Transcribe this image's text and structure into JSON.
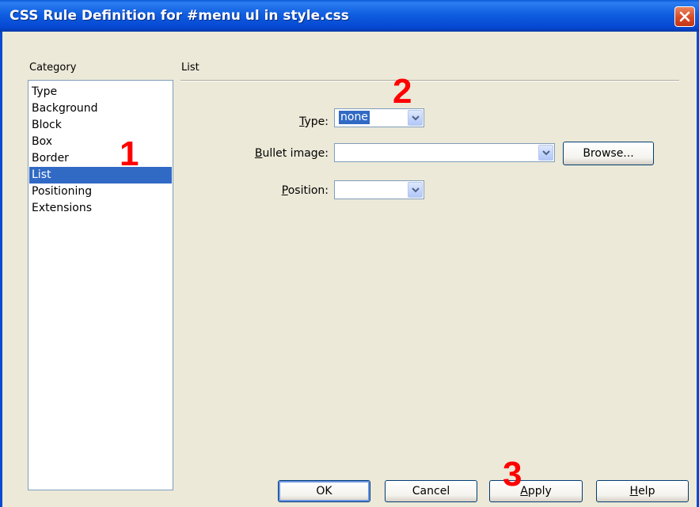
{
  "window": {
    "title": "CSS Rule Definition for #menu ul in style.css"
  },
  "category": {
    "label": "Category",
    "items": [
      "Type",
      "Background",
      "Block",
      "Box",
      "Border",
      "List",
      "Positioning",
      "Extensions"
    ],
    "selected": "List"
  },
  "section": {
    "label": "List"
  },
  "fields": {
    "type": {
      "label_accel": "T",
      "label_rest": "ype:",
      "value": "none"
    },
    "bullet_image": {
      "label_accel": "B",
      "label_rest": "ullet image:",
      "value": ""
    },
    "position": {
      "label_accel": "P",
      "label_rest": "osition:",
      "value": ""
    }
  },
  "buttons": {
    "browse": "Browse...",
    "ok": "OK",
    "cancel": "Cancel",
    "apply_accel": "A",
    "apply_rest": "pply",
    "help_accel": "H",
    "help_rest": "elp"
  },
  "annotations": {
    "one": "1",
    "two": "2",
    "three": "3"
  },
  "colors": {
    "title_bar": "#0a5ad8",
    "selection": "#316ac5",
    "dialog_bg": "#ece9d8",
    "annotation": "#ff0000"
  },
  "icons": {
    "close": "close-icon",
    "dropdown": "chevron-down-icon"
  }
}
